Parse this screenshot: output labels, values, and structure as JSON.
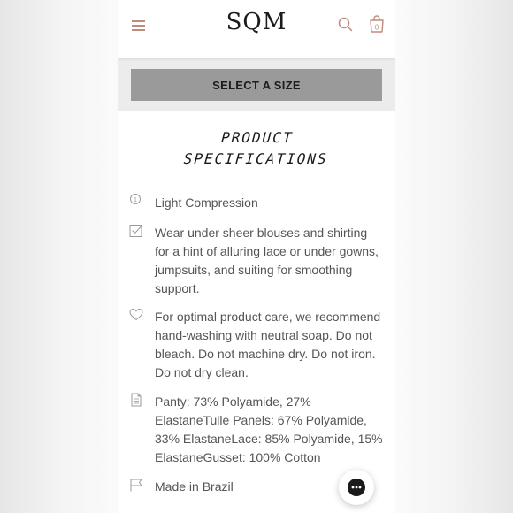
{
  "header": {
    "logo": "SQM",
    "cart_count": "0"
  },
  "size_selector": {
    "label": "SELECT A SIZE"
  },
  "specifications": {
    "title_line1": "PRODUCT",
    "title_line2": "SPECIFICATIONS",
    "items": [
      {
        "icon": "compression-level-icon",
        "text": "Light Compression"
      },
      {
        "icon": "checkbox-icon",
        "text": "Wear under sheer blouses and shirting for a hint of alluring lace or under gowns, jumpsuits, and suiting for smoothing support."
      },
      {
        "icon": "heart-icon",
        "text": "For optimal product care, we recommend hand-washing with neutral soap. Do not bleach. Do not machine dry. Do not iron. Do not dry clean."
      },
      {
        "icon": "document-icon",
        "text": "Panty: 73% Polyamide, 27% ElastaneTulle Panels: 67% Polyamide, 33% ElastaneLace: 85% Polyamide, 15% ElastaneGusset: 100% Cotton"
      },
      {
        "icon": "flag-icon",
        "text": "Made in Brazil"
      }
    ]
  },
  "colors": {
    "accent": "#c08a7c",
    "button_gray": "#9a9a9a",
    "text": "#555555"
  }
}
